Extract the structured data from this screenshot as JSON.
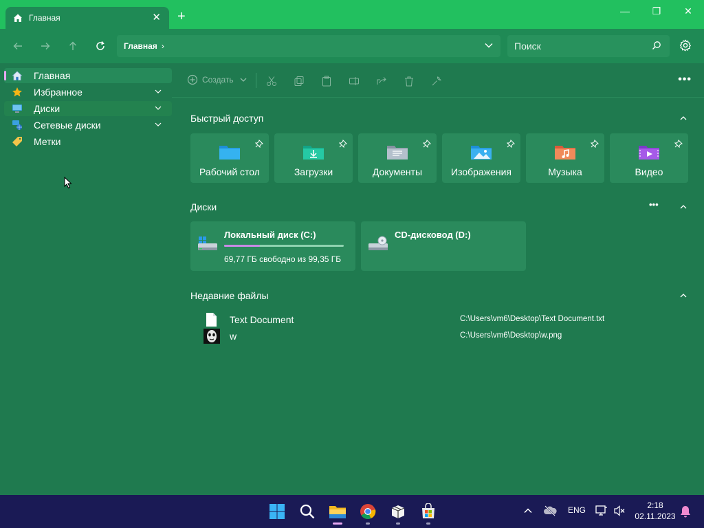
{
  "window": {
    "tab_title": "Главная",
    "tab_close": "✕",
    "new_tab": "+",
    "controls": {
      "minimize": "—",
      "maximize": "❐",
      "close": "✕"
    }
  },
  "toolbar": {
    "breadcrumb": "Главная",
    "breadcrumb_chevron": "›",
    "search_placeholder": "Поиск"
  },
  "sidebar": {
    "items": [
      {
        "label": "Главная",
        "icon": "home-icon",
        "active": true
      },
      {
        "label": "Избранное",
        "icon": "star-icon",
        "expandable": true
      },
      {
        "label": "Диски",
        "icon": "monitor-icon",
        "expandable": true
      },
      {
        "label": "Сетевые диски",
        "icon": "network-icon",
        "expandable": true
      },
      {
        "label": "Метки",
        "icon": "tag-icon"
      }
    ]
  },
  "commandbar": {
    "create_label": "Создать",
    "more": "•••"
  },
  "quick_access": {
    "title": "Быстрый доступ",
    "items": [
      {
        "label": "Рабочий стол",
        "icon": "desktop-folder-icon",
        "color": "#2aa0e8"
      },
      {
        "label": "Загрузки",
        "icon": "downloads-folder-icon",
        "color": "#1fc2a0"
      },
      {
        "label": "Документы",
        "icon": "documents-folder-icon",
        "color": "#9aa7b4"
      },
      {
        "label": "Изображения",
        "icon": "pictures-folder-icon",
        "color": "#3aa6e8"
      },
      {
        "label": "Музыка",
        "icon": "music-folder-icon",
        "color": "#e8704a"
      },
      {
        "label": "Видео",
        "icon": "videos-folder-icon",
        "color": "#9a52d8"
      }
    ]
  },
  "drives": {
    "title": "Диски",
    "more": "•••",
    "items": [
      {
        "name": "Локальный диск (C:)",
        "free": "69,77 ГБ свободно из 99,35 ГБ",
        "used_fraction": 0.3,
        "icon": "hard-drive-icon"
      },
      {
        "name": "CD-дисковод (D:)",
        "free": "",
        "icon": "cd-drive-icon"
      }
    ]
  },
  "recent": {
    "title": "Недавние файлы",
    "items": [
      {
        "name": "Text Document",
        "path": "C:\\Users\\vm6\\Desktop\\Text Document.txt",
        "icon": "text-file-icon"
      },
      {
        "name": "w",
        "path": "C:\\Users\\vm6\\Desktop\\w.png",
        "icon": "image-thumbnail-icon"
      }
    ]
  },
  "taskbar": {
    "language": "ENG",
    "time": "2:18",
    "date": "02.11.2023"
  },
  "colors": {
    "titlebar": "#22c05f",
    "toolbar": "#1f8a55",
    "content": "#1f7a4f",
    "card": "#2a8a5c",
    "taskbar": "#1a1a55",
    "accent": "#e7a8f2"
  }
}
